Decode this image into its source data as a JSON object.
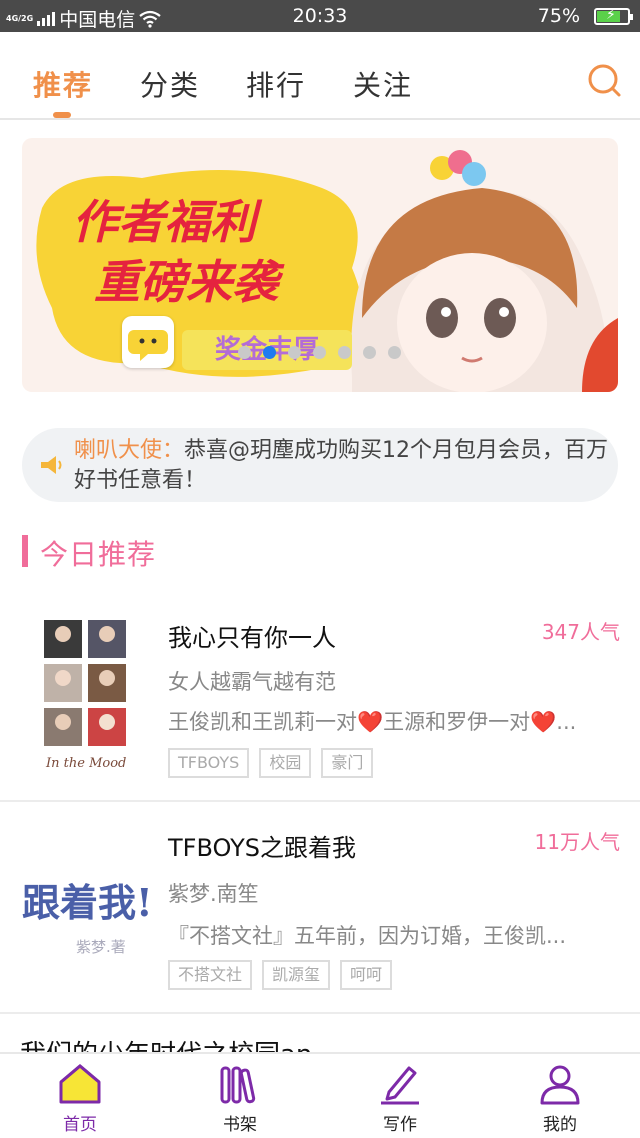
{
  "status_bar": {
    "network_type": "4G/2G",
    "carrier": "中国电信",
    "time": "20:33",
    "battery": "75%",
    "battery_level": 0.75
  },
  "top_tabs": [
    {
      "label": "推荐",
      "active": true
    },
    {
      "label": "分类",
      "active": false
    },
    {
      "label": "排行",
      "active": false
    },
    {
      "label": "关注",
      "active": false
    }
  ],
  "search_icon": "search-icon",
  "banner": {
    "line1": "作者福利",
    "line2": "重磅来袭",
    "bonus": "奖金丰厚",
    "dot_count": 7,
    "active_dot": 1
  },
  "notice": {
    "speaker": "喇叭大使：",
    "message": "恭喜@玥塵成功购买12个月包月会员，百万好书任意看！"
  },
  "section": {
    "title": "今日推荐"
  },
  "books": [
    {
      "title": "我心只有你一人",
      "popularity": "347人气",
      "author": "女人越霸气越有范",
      "description": "王俊凯和王凯莉一对❤️王源和罗伊一对❤️...",
      "tags": [
        "TFBOYS",
        "校园",
        "豪门"
      ],
      "cover_caption": "In the Mood"
    },
    {
      "title": "TFBOYS之跟着我",
      "popularity": "11万人气",
      "author": "紫梦.南笙",
      "description": "『不搭文社』五年前，因为订婚，王俊凯...",
      "tags": [
        "不搭文社",
        "凯源玺",
        "呵呵"
      ],
      "cover_title": "跟着我!",
      "cover_author": "紫梦.著"
    }
  ],
  "next_book_title": "我们的少年时代之校园an",
  "bottom_nav": [
    {
      "label": "首页",
      "icon": "home-icon",
      "active": true
    },
    {
      "label": "书架",
      "icon": "bookshelf-icon",
      "active": false
    },
    {
      "label": "写作",
      "icon": "pen-icon",
      "active": false
    },
    {
      "label": "我的",
      "icon": "profile-icon",
      "active": false
    }
  ],
  "colors": {
    "accent_orange": "#f0904a",
    "pink": "#f06d9a",
    "purple": "#7d2aa8",
    "active_dot": "#1f7bf0"
  }
}
